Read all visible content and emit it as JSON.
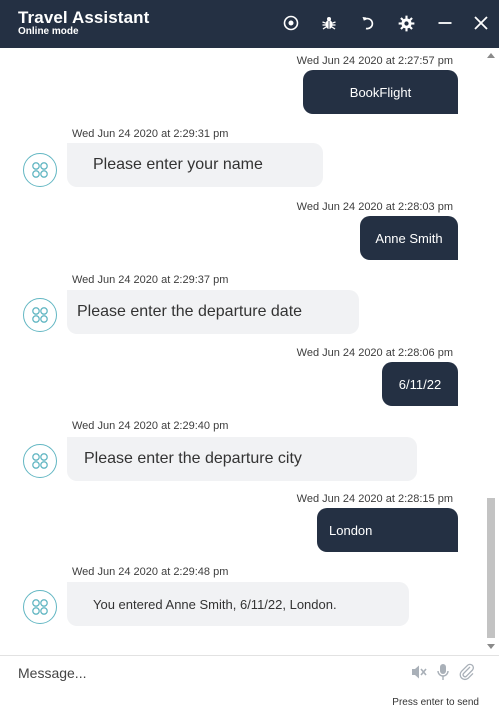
{
  "header": {
    "title": "Travel Assistant",
    "subtitle": "Online mode",
    "icons": [
      "record-icon",
      "bug-icon",
      "refresh-icon",
      "settings-icon",
      "minimize-icon",
      "close-icon"
    ]
  },
  "messages": [
    {
      "from": "user",
      "time": "Wed Jun 24 2020 at 2:27:57 pm",
      "text": "BookFlight"
    },
    {
      "from": "bot",
      "time": "Wed Jun 24 2020 at 2:29:31 pm",
      "text": "Please enter your name"
    },
    {
      "from": "user",
      "time": "Wed Jun 24 2020 at 2:28:03 pm",
      "text": "Anne Smith"
    },
    {
      "from": "bot",
      "time": "Wed Jun 24 2020 at 2:29:37 pm",
      "text": "Please enter the departure date"
    },
    {
      "from": "user",
      "time": "Wed Jun 24 2020 at 2:28:06 pm",
      "text": "6/11/22"
    },
    {
      "from": "bot",
      "time": "Wed Jun 24 2020 at 2:29:40 pm",
      "text": "Please enter the departure city"
    },
    {
      "from": "user",
      "time": "Wed Jun 24 2020 at 2:28:15 pm",
      "text": "London"
    },
    {
      "from": "bot",
      "time": "Wed Jun 24 2020 at 2:29:48 pm",
      "text": "You entered Anne Smith, 6/11/22, London."
    }
  ],
  "composer": {
    "placeholder": "Message...",
    "hint": "Press enter to send",
    "icons": [
      "speaker-muted-icon",
      "microphone-icon",
      "paperclip-icon"
    ]
  },
  "colors": {
    "header_bg": "#243043",
    "user_bubble": "#243043",
    "bot_bubble": "#f1f2f4",
    "avatar_border": "#63b7c3"
  }
}
